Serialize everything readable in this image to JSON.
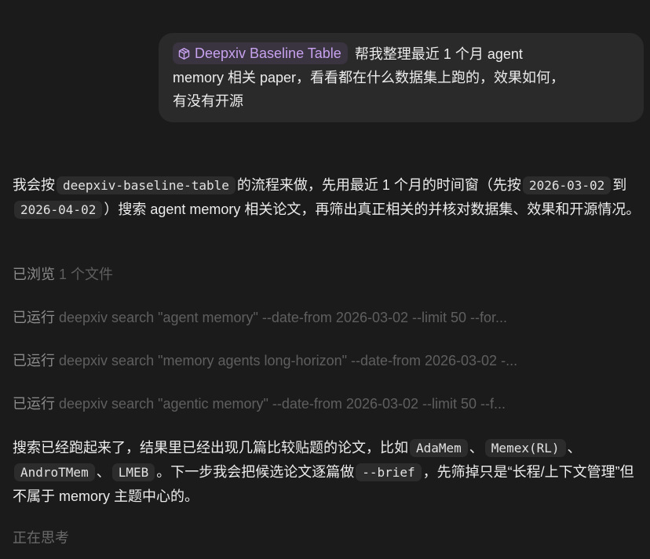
{
  "user_message": {
    "tag_label": "Deepxiv Baseline Table",
    "line1_text": "帮我整理最近 1 个月 agent",
    "line2_text": "memory 相关 paper，看看都在什么数据集上跑的，效果如何，",
    "line3_text": "有没有开源"
  },
  "agent_message_1": {
    "part1": "我会按",
    "code1": "deepxiv-baseline-table",
    "part2": "的流程来做，先用最近 1 个月的时间窗（先按",
    "code2": "2026-03-02",
    "part3": "到",
    "code3": "2026-04-02",
    "part4": "）搜索 agent memory 相关论文，再筛出真正相关的并核对数据集、效果和开源情况。"
  },
  "status_items": [
    {
      "verb": "已浏览",
      "detail": "1 个文件"
    },
    {
      "verb": "已运行",
      "detail": "deepxiv search \"agent memory\" --date-from 2026-03-02 --limit 50 --for..."
    },
    {
      "verb": "已运行",
      "detail": "deepxiv search \"memory agents long-horizon\" --date-from 2026-03-02 -..."
    },
    {
      "verb": "已运行",
      "detail": "deepxiv search \"agentic memory\" --date-from 2026-03-02 --limit 50 --f..."
    }
  ],
  "agent_message_2": {
    "part1": "搜索已经跑起来了，结果里已经出现几篇比较贴题的论文，比如",
    "code1": "AdaMem",
    "sep1": "、",
    "code2": "Memex(RL)",
    "sep2": "、",
    "code3": "AndroTMem",
    "sep3": "、",
    "code4": "LMEB",
    "part2": "。下一步我会把候选论文逐篇做",
    "code5": "--brief",
    "part3": "，先筛掉只是“长程/上下文管理”但不属于 memory 主题中心的。"
  },
  "thinking_label": "正在思考",
  "colors": {
    "background": "#1b1b1b",
    "bubble": "#2a2a2a",
    "tag_text": "#c7a2ef",
    "tag_bg": "#3a3340",
    "code_bg": "#2c2c2c"
  }
}
